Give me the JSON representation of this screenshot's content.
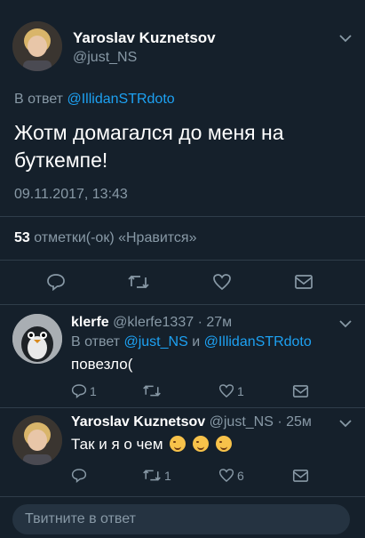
{
  "main_tweet": {
    "author_name": "Yaroslav Kuznetsov",
    "author_handle": "@just_NS",
    "reply_prefix": "В ответ",
    "reply_to": "@IllidanSTRdoto",
    "text_line1": "Жотм домагался до меня на",
    "text_line2": "буткемпе!",
    "timestamp": "09.11.2017, 13:43",
    "likes_count": "53",
    "likes_label": "отметки(-ок) «Нравится»"
  },
  "reply1": {
    "author_name": "klerfe",
    "author_handle": "@klerfe1337",
    "time": "· 27м",
    "reply_prefix": "В ответ",
    "reply_to_1": "@just_NS",
    "and": "и",
    "reply_to_2": "@IllidanSTRdoto",
    "text": "повезло(",
    "reply_count": "1",
    "retweet_count": "",
    "like_count": "1"
  },
  "reply2": {
    "author_name": "Yaroslav Kuznetsov",
    "author_handle": "@just_NS",
    "time": "· 25м",
    "text": "Так и я о чем",
    "retweet_count": "1",
    "like_count": "6"
  },
  "composer": {
    "placeholder": "Твитните в ответ"
  },
  "icons": {
    "reply": "reply-icon",
    "retweet": "retweet-icon",
    "like": "heart-icon",
    "dm": "mail-icon",
    "chevron": "chevron-down-icon",
    "emoji": "wink-emoji-icon"
  },
  "colors": {
    "background": "#15202b",
    "accent": "#1da1f2",
    "muted": "#8899a6",
    "divider": "#2f3d4a"
  }
}
